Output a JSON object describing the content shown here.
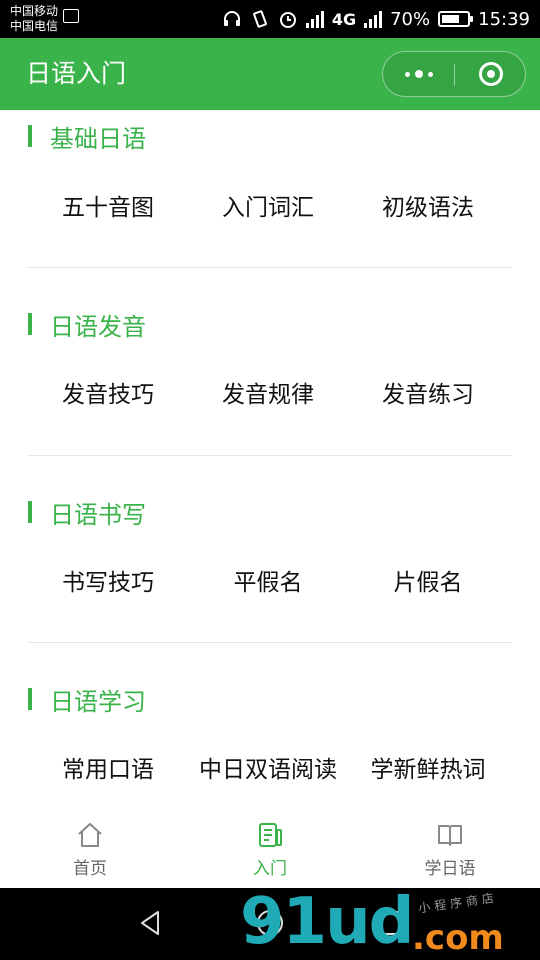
{
  "status_bar": {
    "carrier_1": "中国移动",
    "carrier_2": "中国电信",
    "network_1": "4G",
    "battery": "70%",
    "battery_level": 0.7,
    "time": "15:39",
    "icons": [
      "gallery-icon",
      "headphones-icon",
      "vibrate-icon",
      "alarm-icon",
      "signal-icon",
      "battery-icon"
    ]
  },
  "header": {
    "title": "日语入门",
    "menu_icon": "more-dots-icon",
    "close_icon": "target-ring-icon",
    "background": "#3ab34a"
  },
  "sections": [
    {
      "title": "基础日语",
      "items": [
        "五十音图",
        "入门词汇",
        "初级语法"
      ]
    },
    {
      "title": "日语发音",
      "items": [
        "发音技巧",
        "发音规律",
        "发音练习"
      ]
    },
    {
      "title": "日语书写",
      "items": [
        "书写技巧",
        "平假名",
        "片假名"
      ]
    },
    {
      "title": "日语学习",
      "items": [
        "常用口语",
        "中日双语阅读",
        "学新鲜热词"
      ]
    }
  ],
  "tabbar": {
    "tabs": [
      {
        "label": "首页",
        "icon": "home-icon",
        "active": false
      },
      {
        "label": "入门",
        "icon": "notebook-pen-icon",
        "active": true
      },
      {
        "label": "学日语",
        "icon": "open-book-icon",
        "active": false
      }
    ],
    "active_color": "#3ab34a",
    "inactive_color": "#666666"
  },
  "watermark": {
    "main": "91ud",
    "suffix": ".com",
    "small": "小程序商店"
  }
}
